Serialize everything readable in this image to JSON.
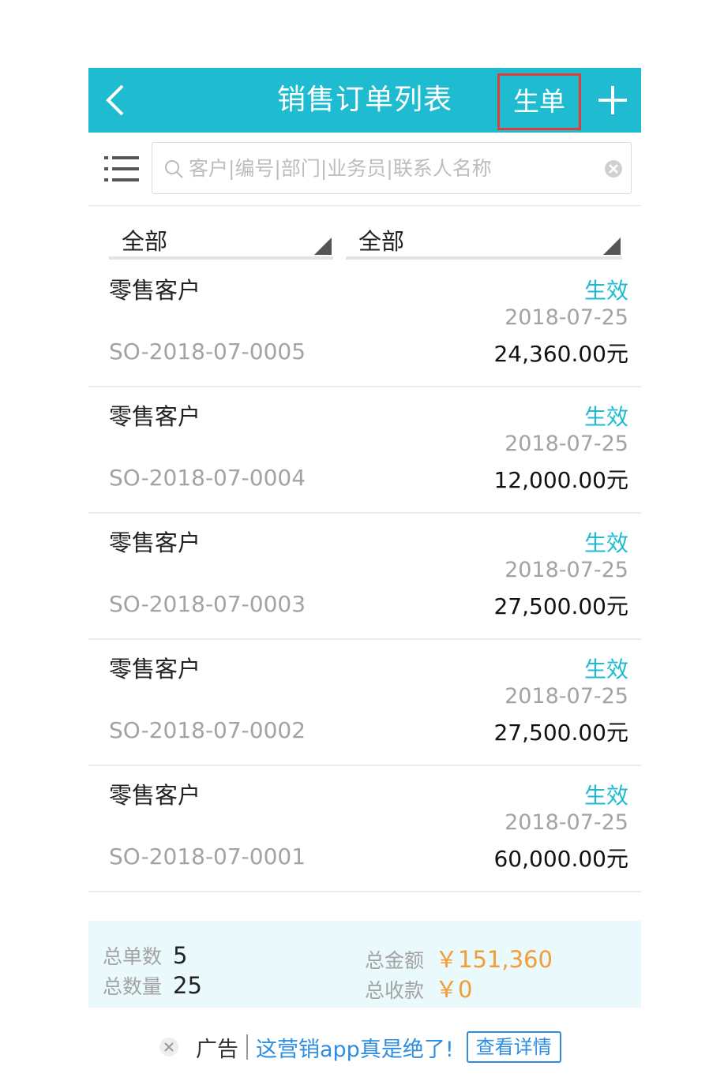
{
  "header": {
    "title": "销售订单列表",
    "generate_label": "生单"
  },
  "search": {
    "placeholder": "客户|编号|部门|业务员|联系人名称"
  },
  "filters": [
    {
      "label": "全部"
    },
    {
      "label": "全部"
    }
  ],
  "orders": [
    {
      "customer": "零售客户",
      "status": "生效",
      "date": "2018-07-25",
      "code": "SO-2018-07-0005",
      "amount": "24,360.00元"
    },
    {
      "customer": "零售客户",
      "status": "生效",
      "date": "2018-07-25",
      "code": "SO-2018-07-0004",
      "amount": "12,000.00元"
    },
    {
      "customer": "零售客户",
      "status": "生效",
      "date": "2018-07-25",
      "code": "SO-2018-07-0003",
      "amount": "27,500.00元"
    },
    {
      "customer": "零售客户",
      "status": "生效",
      "date": "2018-07-25",
      "code": "SO-2018-07-0002",
      "amount": "27,500.00元"
    },
    {
      "customer": "零售客户",
      "status": "生效",
      "date": "2018-07-25",
      "code": "SO-2018-07-0001",
      "amount": "60,000.00元"
    }
  ],
  "summary": {
    "total_orders_label": "总单数",
    "total_orders": "5",
    "total_qty_label": "总数量",
    "total_qty": "25",
    "total_amount_label": "总金额",
    "total_amount": "￥151,360",
    "total_received_label": "总收款",
    "total_received": "￥0"
  },
  "ad": {
    "label": "广告",
    "text": "这营销app真是绝了!",
    "button": "查看详情"
  },
  "colors": {
    "accent": "#1fbbd1",
    "highlight_box": "#e03c3c",
    "money": "#f39c38",
    "link": "#2c8de2"
  },
  "icons": [
    "back-arrow-icon",
    "plus-icon",
    "menu-list-icon",
    "search-icon",
    "clear-icon",
    "dropdown-triangle-icon",
    "close-icon"
  ]
}
